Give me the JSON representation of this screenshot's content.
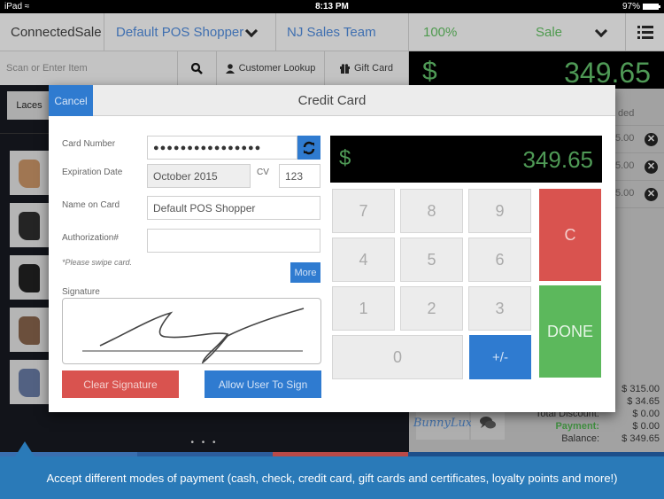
{
  "statusbar": {
    "device": "iPad",
    "time": "8:13 PM",
    "battery": "97%",
    "battery_level": 0.97
  },
  "header": {
    "app_name": "ConnectedSale",
    "customer": "Default POS Shopper",
    "team": "NJ Sales Team",
    "percent": "100%",
    "mode": "Sale"
  },
  "toolbar": {
    "scan_placeholder": "Scan or Enter Item",
    "customer_lookup": "Customer Lookup",
    "gift_card": "Gift Card"
  },
  "total": {
    "currency": "$",
    "amount": "349.65"
  },
  "categories": {
    "selected": "Laces"
  },
  "products": [
    "tan-sneaker",
    "black-high-top",
    "black-suede-boot",
    "brown-boot",
    "plaid-strap-sneaker"
  ],
  "cart": {
    "header_partial": "ded",
    "rows": [
      {
        "amount_partial": "5.00"
      },
      {
        "amount_partial": "5.00"
      },
      {
        "amount_partial": "5.00"
      }
    ]
  },
  "totals": {
    "rows": [
      {
        "label": "",
        "value": "$ 315.00"
      },
      {
        "label": "",
        "value": "$ 34.65"
      },
      {
        "label": "Total Discount:",
        "value": "$ 0.00"
      },
      {
        "label": "Payment:",
        "value": "$ 0.00"
      },
      {
        "label": "Balance:",
        "value": "$ 349.65"
      }
    ]
  },
  "brand_logo": "BunnyLux",
  "modal": {
    "title": "Credit Card",
    "cancel": "Cancel",
    "card_number_label": "Card Number",
    "card_number_value": "●●●●●●●●●●●●●●●●",
    "expiration_label": "Expiration Date",
    "expiration_value": "October 2015",
    "cv_label": "CV",
    "cv_value": "123",
    "name_label": "Name on Card",
    "name_value": "Default POS Shopper",
    "auth_label": "Authorization#",
    "auth_value": "",
    "hint": "*Please swipe card.",
    "more": "More",
    "signature_label": "Signature",
    "clear_signature": "Clear Signature",
    "allow_sign": "Allow User To Sign",
    "display_currency": "$",
    "display_amount": "349.65",
    "keys": {
      "k7": "7",
      "k8": "8",
      "k9": "9",
      "k4": "4",
      "k5": "5",
      "k6": "6",
      "k1": "1",
      "k2": "2",
      "k3": "3",
      "k0": "0",
      "plusminus": "+/-",
      "clear": "C",
      "done": "DONE"
    }
  },
  "pager": "• • •",
  "footer": {
    "caption": "Accept different modes of payment (cash, check, credit card, gift cards and certificates, loyalty points and more!)"
  },
  "colors": {
    "accent_blue": "#2f7bd0",
    "danger_red": "#d9534f",
    "success_green": "#5cb85c",
    "amount_green": "#4f9a56",
    "footer_blue": "#2a7ab8"
  }
}
